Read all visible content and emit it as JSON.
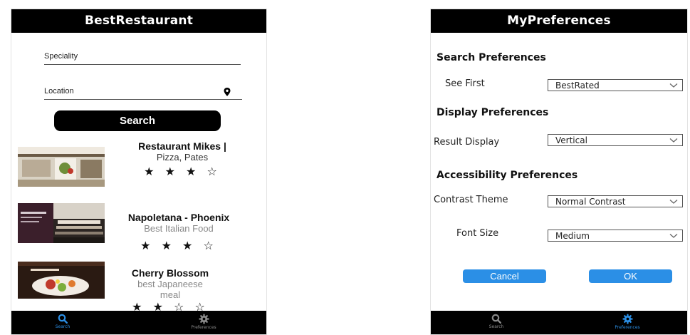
{
  "left": {
    "title": "BestRestaurant",
    "speciality_placeholder": "Speciality",
    "location_placeholder": "Location",
    "search_label": "Search",
    "results": [
      {
        "name": "Restaurant Mikes |",
        "subtitle": "Pizza, Pates",
        "rating": 3.5,
        "stars": "★ ★ ★ ☆"
      },
      {
        "name": "Napoletana - Phoenix",
        "subtitle": "Best Italian Food",
        "rating": 3.5,
        "stars": "★ ★ ★ ☆"
      },
      {
        "name": "Cherry Blossom",
        "subtitle": "best Japaneese meal",
        "rating": 2.5,
        "stars": "★ ★ ☆ ☆"
      }
    ],
    "tabs": {
      "search": "Search",
      "preferences": "Preferences"
    }
  },
  "right": {
    "title": "MyPreferences",
    "sections": {
      "search": "Search Preferences",
      "display": "Display Preferences",
      "accessibility": "Accessibility Preferences"
    },
    "fields": {
      "see_first": {
        "label": "See First",
        "value": "BestRated"
      },
      "result_display": {
        "label": "Result Display",
        "value": "Vertical"
      },
      "contrast_theme": {
        "label": "Contrast Theme",
        "value": "Normal Contrast"
      },
      "font_size": {
        "label": "Font Size",
        "value": "Medium"
      }
    },
    "buttons": {
      "cancel": "Cancel",
      "ok": "OK"
    },
    "tabs": {
      "search": "Search",
      "preferences": "Preferences"
    }
  },
  "colors": {
    "header": "#000000",
    "active_tab": "#2b8fe6",
    "inactive_tab": "#8a8a8a",
    "button_blue": "#2b8fe6"
  },
  "icons": [
    "location-pin-icon",
    "search-icon",
    "gear-icon",
    "chevron-down-icon"
  ]
}
